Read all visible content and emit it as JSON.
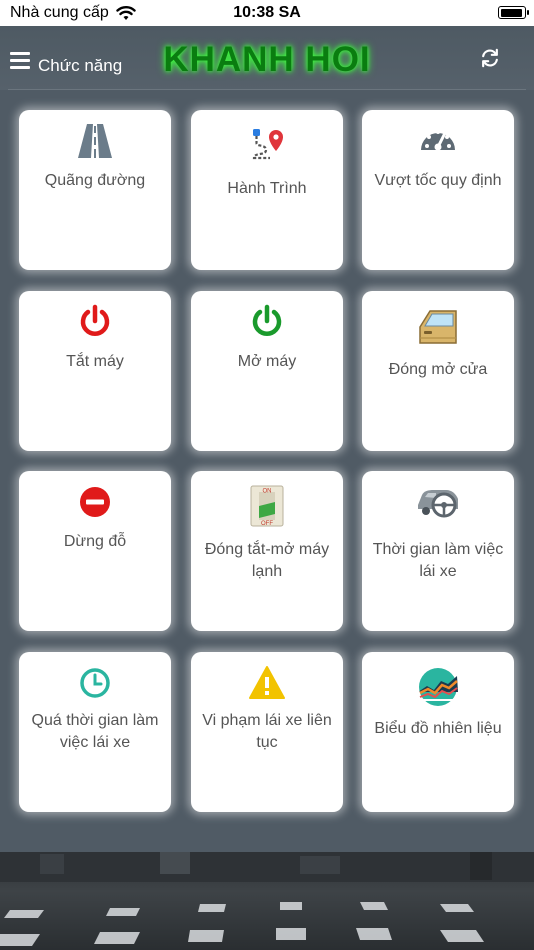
{
  "status_bar": {
    "carrier": "Nhà cung cấp",
    "time": "10:38 SA",
    "battery_level": 0.95
  },
  "header": {
    "menu_label": "Chức năng",
    "brand": "KHANH HOI"
  },
  "tiles": [
    {
      "label": "Quãng đường",
      "icon": "road-icon"
    },
    {
      "label": "Hành Trình",
      "icon": "route-icon"
    },
    {
      "label": "Vượt tốc quy định",
      "icon": "speedometer-icon"
    },
    {
      "label": "Tắt máy",
      "icon": "power-off-icon"
    },
    {
      "label": "Mở máy",
      "icon": "power-on-icon"
    },
    {
      "label": "Đóng mở cửa",
      "icon": "car-door-icon"
    },
    {
      "label": "Dừng đỗ",
      "icon": "stop-icon"
    },
    {
      "label": "Đóng tắt-mở máy lạnh",
      "icon": "ac-switch-icon",
      "switch_on": "ON",
      "switch_off": "OFF"
    },
    {
      "label": "Thời gian làm việc lái xe",
      "icon": "steering-icon"
    },
    {
      "label": "Quá thời gian làm việc lái xe",
      "icon": "clock-icon"
    },
    {
      "label": "Vi phạm lái xe liên tục",
      "icon": "warning-icon"
    },
    {
      "label": "Biểu đồ nhiên liệu",
      "icon": "chart-icon"
    }
  ],
  "colors": {
    "background": "#4f5a64",
    "brand": "#0a7d10",
    "brand_glow": "#3cff3c",
    "tile": "#ffffff",
    "label": "#555555",
    "red": "#e01a1a",
    "green": "#1a9a2c",
    "teal": "#2ab5a0",
    "warning": "#f2c300",
    "road": "#6b7c8a"
  }
}
